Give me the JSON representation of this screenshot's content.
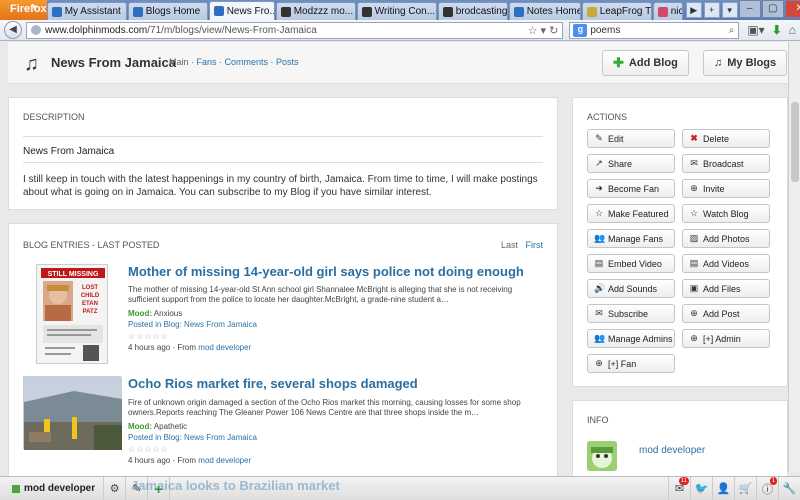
{
  "browser": {
    "app_button": "Firefox",
    "tabs": [
      {
        "label": "My Assistant",
        "color": "#2f6fc2"
      },
      {
        "label": "Blogs Home",
        "color": "#2f6fc2"
      },
      {
        "label": "News Fro...",
        "color": "#2f6fc2",
        "active": true
      },
      {
        "label": "Modzzz mo...",
        "color": "#333333"
      },
      {
        "label": "Writing Con...",
        "color": "#333333"
      },
      {
        "label": "brodcasting...",
        "color": "#333333"
      },
      {
        "label": "Notes Home",
        "color": "#2f6fc2"
      },
      {
        "label": "LeapFrog T...",
        "color": "#c9a83a"
      },
      {
        "label": "nick",
        "color": "#d04a6a"
      }
    ],
    "url_host": "www.dolphinmods.com",
    "url_path": "/71/m/blogs/view/News-From-Jamaica",
    "search_engine": "g",
    "search_value": "poems"
  },
  "header": {
    "title": "News From Jamaica",
    "nav": [
      "Main",
      "Fans",
      "Comments",
      "Posts"
    ],
    "add_blog": "Add Blog",
    "my_blogs": "My Blogs"
  },
  "description": {
    "title": "DESCRIPTION",
    "name": "News From Jamaica",
    "body": "I still keep in touch with the latest happenings in my country of birth, Jamaica. From time to time, I will make postings about what is going on in Jamaica. You can subscribe to my Blog if you have similar interest."
  },
  "entries": {
    "title": "BLOG ENTRIES - LAST POSTED",
    "pager_last": "Last",
    "pager_first": "First",
    "items": [
      {
        "title": "Mother of missing 14-year-old girl says police not doing enough",
        "summary": "The mother of missing 14-year-old St Ann school girl Shannalee McBright is alleging that she is not receiving sufficient support from the police to locate her daughter.McBright, a grade-nine student a…",
        "mood_label": "Mood:",
        "mood": "Anxious",
        "posted_label": "Posted in Blog:",
        "blog": "News From Jamaica",
        "time": "4 hours ago",
        "from_label": "From",
        "author": "mod developer",
        "poster": {
          "l1": "STILL MISSING",
          "l2": "LOST",
          "l3": "CHILD",
          "l4": "ETAN",
          "l5": "PATZ"
        }
      },
      {
        "title": "Ocho Rios market fire, several shops damaged",
        "summary": "Fire of unknown origin damaged a section of the Ocho Rios market this morning, causing losses for some shop owners.Reports reaching The Gleaner Power 106 News Centre are that three shops inside the m…",
        "mood_label": "Mood:",
        "mood": "Apathetic",
        "posted_label": "Posted in Blog:",
        "blog": "News From Jamaica",
        "time": "4 hours ago",
        "from_label": "From",
        "author": "mod developer"
      }
    ],
    "partial_title": "Jamaica looks to Brazilian market"
  },
  "actions": {
    "title": "ACTIONS",
    "buttons": [
      {
        "label": "Edit",
        "icon": "edit-icon"
      },
      {
        "label": "Delete",
        "icon": "delete-icon"
      },
      {
        "label": "Share",
        "icon": "share-icon"
      },
      {
        "label": "Broadcast",
        "icon": "envelope-icon"
      },
      {
        "label": "Become Fan",
        "icon": "signin-icon"
      },
      {
        "label": "Invite",
        "icon": "plus-circle-icon"
      },
      {
        "label": "Make Featured",
        "icon": "star-icon"
      },
      {
        "label": "Watch Blog",
        "icon": "star-icon"
      },
      {
        "label": "Manage Fans",
        "icon": "users-icon"
      },
      {
        "label": "Add Photos",
        "icon": "picture-icon"
      },
      {
        "label": "Embed Video",
        "icon": "film-icon"
      },
      {
        "label": "Add Videos",
        "icon": "film-icon"
      },
      {
        "label": "Add Sounds",
        "icon": "volume-icon"
      },
      {
        "label": "Add Files",
        "icon": "save-icon"
      },
      {
        "label": "Subscribe",
        "icon": "envelope-icon"
      },
      {
        "label": "Add Post",
        "icon": "plus-circle-icon"
      },
      {
        "label": "Manage Admins",
        "icon": "users-icon"
      },
      {
        "label": "[+] Admin",
        "icon": "plus-circle-icon"
      },
      {
        "label": "[+] Fan",
        "icon": "plus-circle-icon"
      }
    ]
  },
  "info": {
    "title": "INFO",
    "author": "mod developer"
  },
  "bottombar": {
    "user": "mod developer",
    "mail_badge": "11",
    "notif_badge": "1"
  }
}
